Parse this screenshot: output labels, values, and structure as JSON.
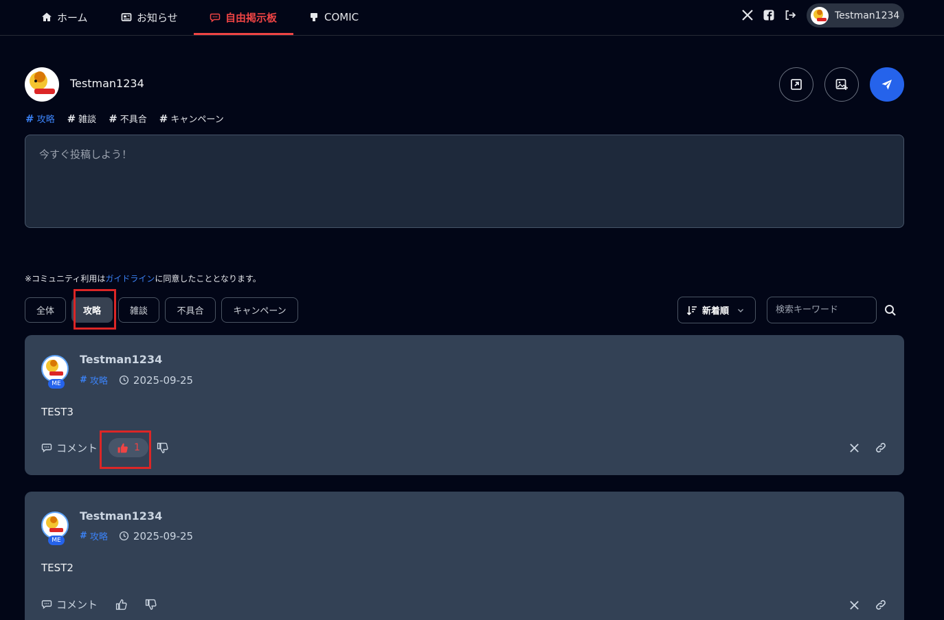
{
  "nav": {
    "items": [
      {
        "label": "ホーム",
        "icon": "home-icon"
      },
      {
        "label": "お知らせ",
        "icon": "news-icon"
      },
      {
        "label": "自由掲示板",
        "icon": "chat-icon",
        "active": true
      },
      {
        "label": "COMIC",
        "icon": "comic-icon"
      }
    ],
    "user": "Testman1234"
  },
  "composer": {
    "author": "Testman1234",
    "hashtags": [
      "攻略",
      "雑談",
      "不具合",
      "キャンペーン"
    ],
    "placeholder": "今すぐ投稿しよう！"
  },
  "notice": {
    "prefix": "※コミュニティ利用は",
    "link": "ガイドライン",
    "suffix": "に同意したこととなります。"
  },
  "filters": {
    "items": [
      "全体",
      "攻略",
      "雑談",
      "不具合",
      "キャンペーン"
    ],
    "active": "攻略",
    "sort_label": "新着順",
    "search_placeholder": "検索キーワード"
  },
  "posts": [
    {
      "author": "Testman1234",
      "badge": "ME",
      "tag": "攻略",
      "date": "2025-09-25",
      "body": "TEST3",
      "comment_label": "コメント",
      "likes": "1",
      "liked": true
    },
    {
      "author": "Testman1234",
      "badge": "ME",
      "tag": "攻略",
      "date": "2025-09-25",
      "body": "TEST2",
      "comment_label": "コメント",
      "likes": "",
      "liked": false
    }
  ],
  "colors": {
    "accent": "#ef4444",
    "primary": "#2563eb",
    "link": "#3b82f6",
    "card": "#334155",
    "background": "#020617"
  }
}
